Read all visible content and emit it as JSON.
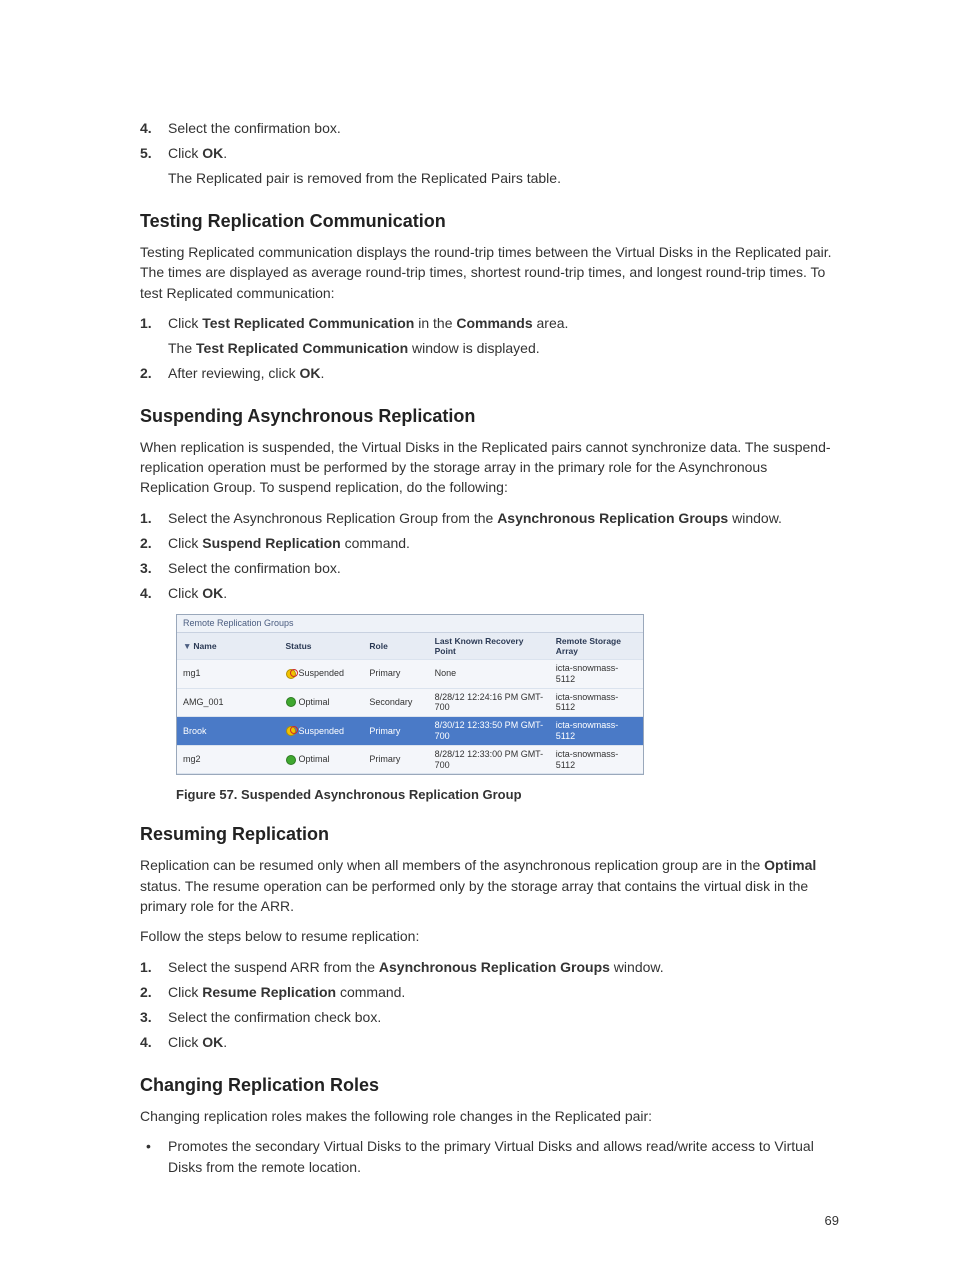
{
  "intro_list": [
    {
      "num": "4.",
      "parts": [
        "Select the confirmation box."
      ]
    },
    {
      "num": "5.",
      "parts": [
        "Click ",
        {
          "b": "OK"
        },
        "."
      ],
      "sub": "The Replicated pair is removed from the Replicated Pairs table."
    }
  ],
  "sec_testing": {
    "heading": "Testing Replication Communication",
    "para": "Testing Replicated communication displays the round-trip times between the Virtual Disks in the Replicated pair. The times are displayed as average round-trip times, shortest round-trip times, and longest round-trip times. To test Replicated communication:",
    "list": [
      {
        "num": "1.",
        "parts": [
          "Click ",
          {
            "b": "Test Replicated Communication"
          },
          " in the ",
          {
            "b": "Commands"
          },
          " area."
        ],
        "sub_parts": [
          "The ",
          {
            "b": "Test Replicated Communication"
          },
          " window is displayed."
        ]
      },
      {
        "num": "2.",
        "parts": [
          "After reviewing, click ",
          {
            "b": "OK"
          },
          "."
        ]
      }
    ]
  },
  "sec_suspend": {
    "heading": "Suspending Asynchronous Replication",
    "para": "When replication is suspended, the Virtual Disks in the Replicated pairs cannot synchronize data. The suspend-replication operation must be performed by the storage array in the primary role for the Asynchronous Replication Group. To suspend replication, do the following:",
    "list": [
      {
        "num": "1.",
        "parts": [
          "Select the Asynchronous Replication Group from the ",
          {
            "b": "Asynchronous Replication Groups"
          },
          " window."
        ]
      },
      {
        "num": "2.",
        "parts": [
          "Click ",
          {
            "b": "Suspend Replication"
          },
          " command."
        ]
      },
      {
        "num": "3.",
        "parts": [
          "Select the confirmation box."
        ]
      },
      {
        "num": "4.",
        "parts": [
          "Click ",
          {
            "b": "OK"
          },
          "."
        ]
      }
    ]
  },
  "table": {
    "caption": "Remote Replication Groups",
    "cols": [
      "Name",
      "Status",
      "Role",
      "Last Known Recovery Point",
      "Remote Storage Array"
    ],
    "rows": [
      {
        "name": "mg1",
        "status": "Suspended",
        "status_kind": "suspended",
        "role": "Primary",
        "recovery": "None",
        "remote": "icta-snowmass-5112",
        "selected": false
      },
      {
        "name": "AMG_001",
        "status": "Optimal",
        "status_kind": "optimal",
        "role": "Secondary",
        "recovery": "8/28/12 12:24:16 PM GMT-700",
        "remote": "icta-snowmass-5112",
        "selected": false
      },
      {
        "name": "Brook",
        "status": "Suspended",
        "status_kind": "suspended",
        "role": "Primary",
        "recovery": "8/30/12 12:33:50 PM GMT-700",
        "remote": "icta-snowmass-5112",
        "selected": true
      },
      {
        "name": "mg2",
        "status": "Optimal",
        "status_kind": "optimal",
        "role": "Primary",
        "recovery": "8/28/12 12:33:00 PM GMT-700",
        "remote": "icta-snowmass-5112",
        "selected": false
      }
    ],
    "figure_caption": "Figure 57. Suspended Asynchronous Replication Group"
  },
  "sec_resume": {
    "heading": "Resuming Replication",
    "para_parts": [
      "Replication can be resumed only when all members of the asynchronous replication group are in the ",
      {
        "b": "Optimal"
      },
      " status. The resume operation can be performed only by the storage array that contains the virtual disk in the primary role for the ARR."
    ],
    "para2": "Follow the steps below to resume replication:",
    "list": [
      {
        "num": "1.",
        "parts": [
          "Select the suspend ARR from the ",
          {
            "b": "Asynchronous Replication Groups"
          },
          " window."
        ]
      },
      {
        "num": "2.",
        "parts": [
          "Click ",
          {
            "b": "Resume Replication"
          },
          " command."
        ]
      },
      {
        "num": "3.",
        "parts": [
          "Select the confirmation check box."
        ]
      },
      {
        "num": "4.",
        "parts": [
          "Click ",
          {
            "b": "OK"
          },
          "."
        ]
      }
    ]
  },
  "sec_roles": {
    "heading": "Changing Replication Roles",
    "para": "Changing replication roles makes the following role changes in the Replicated pair:",
    "bullets": [
      "Promotes the secondary Virtual Disks to the primary Virtual Disks and allows read/write access to Virtual Disks from the remote location."
    ]
  },
  "page_number": "69"
}
